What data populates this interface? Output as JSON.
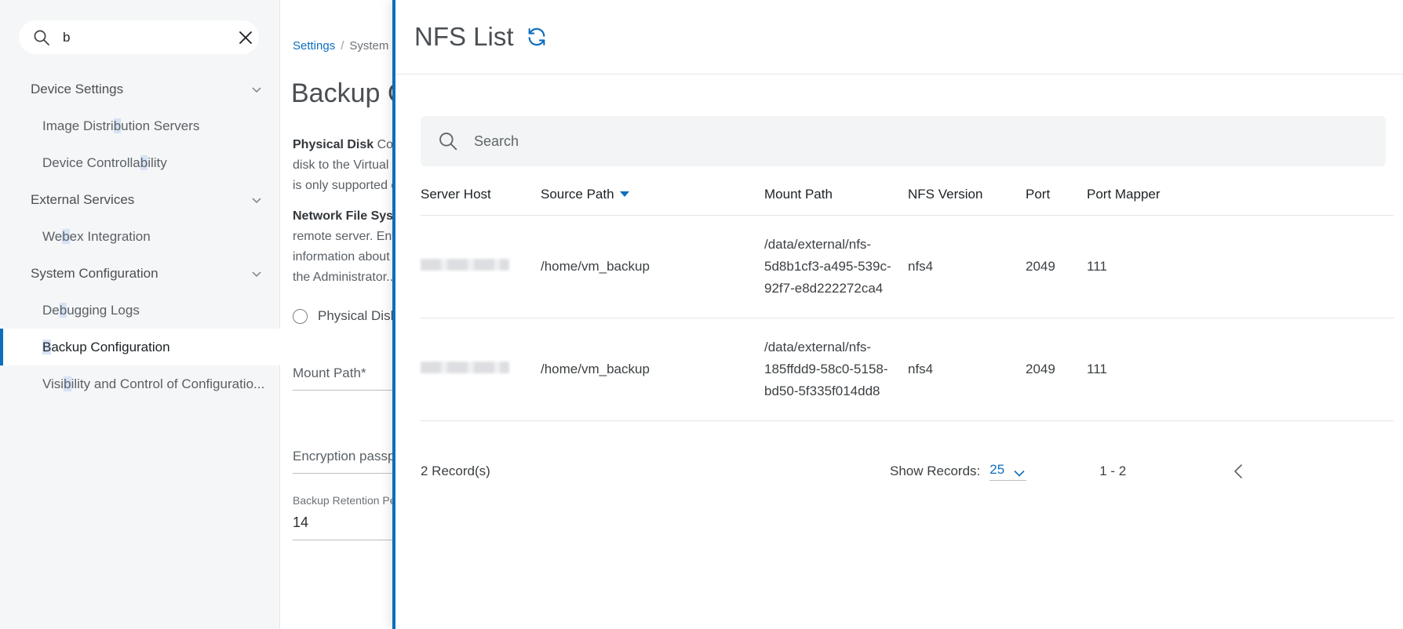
{
  "sidebar": {
    "search": {
      "value": "b",
      "placeholder": "Search",
      "icon": "search-icon",
      "clear_icon": "close-icon"
    },
    "items": [
      {
        "label": "Device Settings",
        "type": "group",
        "highlight": "",
        "icon": "chevron-down-icon"
      },
      {
        "label": "Image Distribution Servers",
        "type": "item",
        "highlight": "b"
      },
      {
        "label": "Device Controllability",
        "type": "item",
        "highlight": "b"
      },
      {
        "label": "External Services",
        "type": "group",
        "highlight": "",
        "icon": "chevron-down-icon"
      },
      {
        "label": "Webex Integration",
        "type": "item",
        "highlight": "b"
      },
      {
        "label": "System Configuration",
        "type": "group",
        "highlight": "",
        "icon": "chevron-down-icon"
      },
      {
        "label": "Debugging Logs",
        "type": "item",
        "highlight": "b"
      },
      {
        "label": "Backup Configuration",
        "type": "item",
        "highlight": "B",
        "selected": true
      },
      {
        "label": "Visibility and Control of Configuratio...",
        "type": "item",
        "highlight": "b"
      }
    ]
  },
  "content": {
    "breadcrumb": {
      "root": "Settings",
      "separator": "/",
      "current": "System"
    },
    "title": "Backup Configuration",
    "paragraph1_bold": "Physical Disk",
    "paragraph1": " Copies the backup to a physical\ndisk to the Virtual machine. This option\nis only supported on...",
    "paragraph2_bold": "Network File System (NFS)",
    "paragraph2": " Copies to a\nremote server. Enter the following\ninformation about the NFS server. For\nthe Administrator...",
    "radio_physical": "Physical Disk",
    "mount_path_label": "Mount Path*",
    "encryption_label": "Encryption passphrase*",
    "retention_label": "Backup Retention Period (Days)*",
    "retention_value": "14"
  },
  "panel": {
    "title": "NFS List",
    "refresh_icon": "refresh-icon",
    "search": {
      "placeholder": "Search",
      "value": "",
      "icon": "search-icon"
    },
    "table": {
      "columns": [
        {
          "key": "server_host",
          "label": "Server Host",
          "sorted": false
        },
        {
          "key": "source_path",
          "label": "Source Path",
          "sorted": true,
          "sort_icon": "sort-descending-icon"
        },
        {
          "key": "mount_path",
          "label": "Mount Path",
          "sorted": false
        },
        {
          "key": "nfs_version",
          "label": "NFS Version",
          "sorted": false
        },
        {
          "key": "port",
          "label": "Port",
          "sorted": false
        },
        {
          "key": "port_mapper",
          "label": "Port Mapper",
          "sorted": false
        }
      ],
      "rows": [
        {
          "server_host": "",
          "server_host_redacted": true,
          "source_path": "/home/vm_backup",
          "mount_path": "/data/external/nfs-5d8b1cf3-a495-539c-92f7-e8d222272ca4",
          "nfs_version": "nfs4",
          "port": "2049",
          "port_mapper": "111"
        },
        {
          "server_host": "",
          "server_host_redacted": true,
          "source_path": "/home/vm_backup",
          "mount_path": "/data/external/nfs-185ffdd9-58c0-5158-bd50-5f335f014dd8",
          "nfs_version": "nfs4",
          "port": "2049",
          "port_mapper": "111"
        }
      ]
    },
    "footer": {
      "record_count": "2 Record(s)",
      "show_records_label": "Show Records:",
      "show_records_value": "25",
      "page_range": "1 - 2",
      "prev_icon": "chevron-left-icon"
    }
  },
  "colors": {
    "accent": "#0d6ebe",
    "panel_border": "#0d6ebe",
    "highlight": "#d6e2f5",
    "sidebar_bg": "#f5f6f7",
    "text": "#3c4043"
  }
}
